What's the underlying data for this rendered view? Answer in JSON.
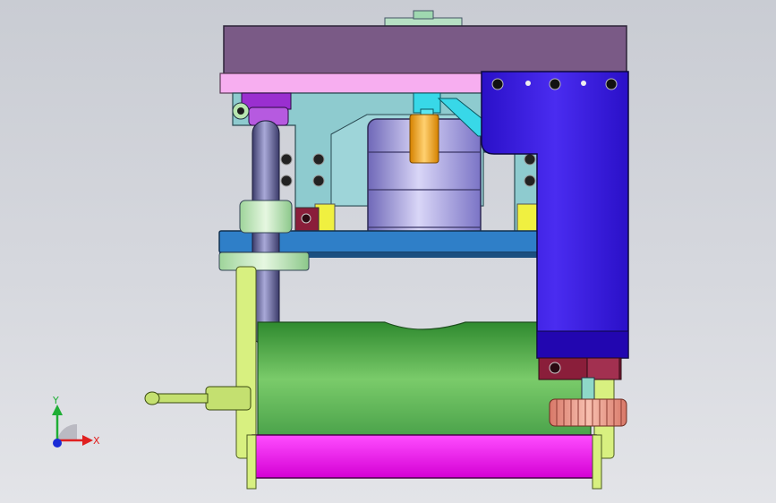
{
  "viewport": {
    "background_top": "#c9ccd3",
    "background_bottom": "#e3e4e8"
  },
  "triad": {
    "y_label": "Y",
    "x_label": "X",
    "y_color": "#1fae35",
    "x_color": "#e02020",
    "z_color": "#1a2bd6"
  },
  "colors": {
    "top_plate": "#7a5a86",
    "pink_plate": "#f7aef0",
    "blue_arm": "#3a16e6",
    "teal_frame": "#8ecbcf",
    "motor": "#9b94e0",
    "cyan_shaft": "#38d8e8",
    "orange_coupling": "#f2a21a",
    "blue_base_plate": "#2f7fc8",
    "green_tank": "#4aa24a",
    "magenta_roller": "#ff00ff",
    "yellow_green_frame": "#d8f080",
    "dark_red_block": "#8a1e3a",
    "salmon_gear": "#f0a090",
    "purple_collar": "#9a2fd0"
  }
}
